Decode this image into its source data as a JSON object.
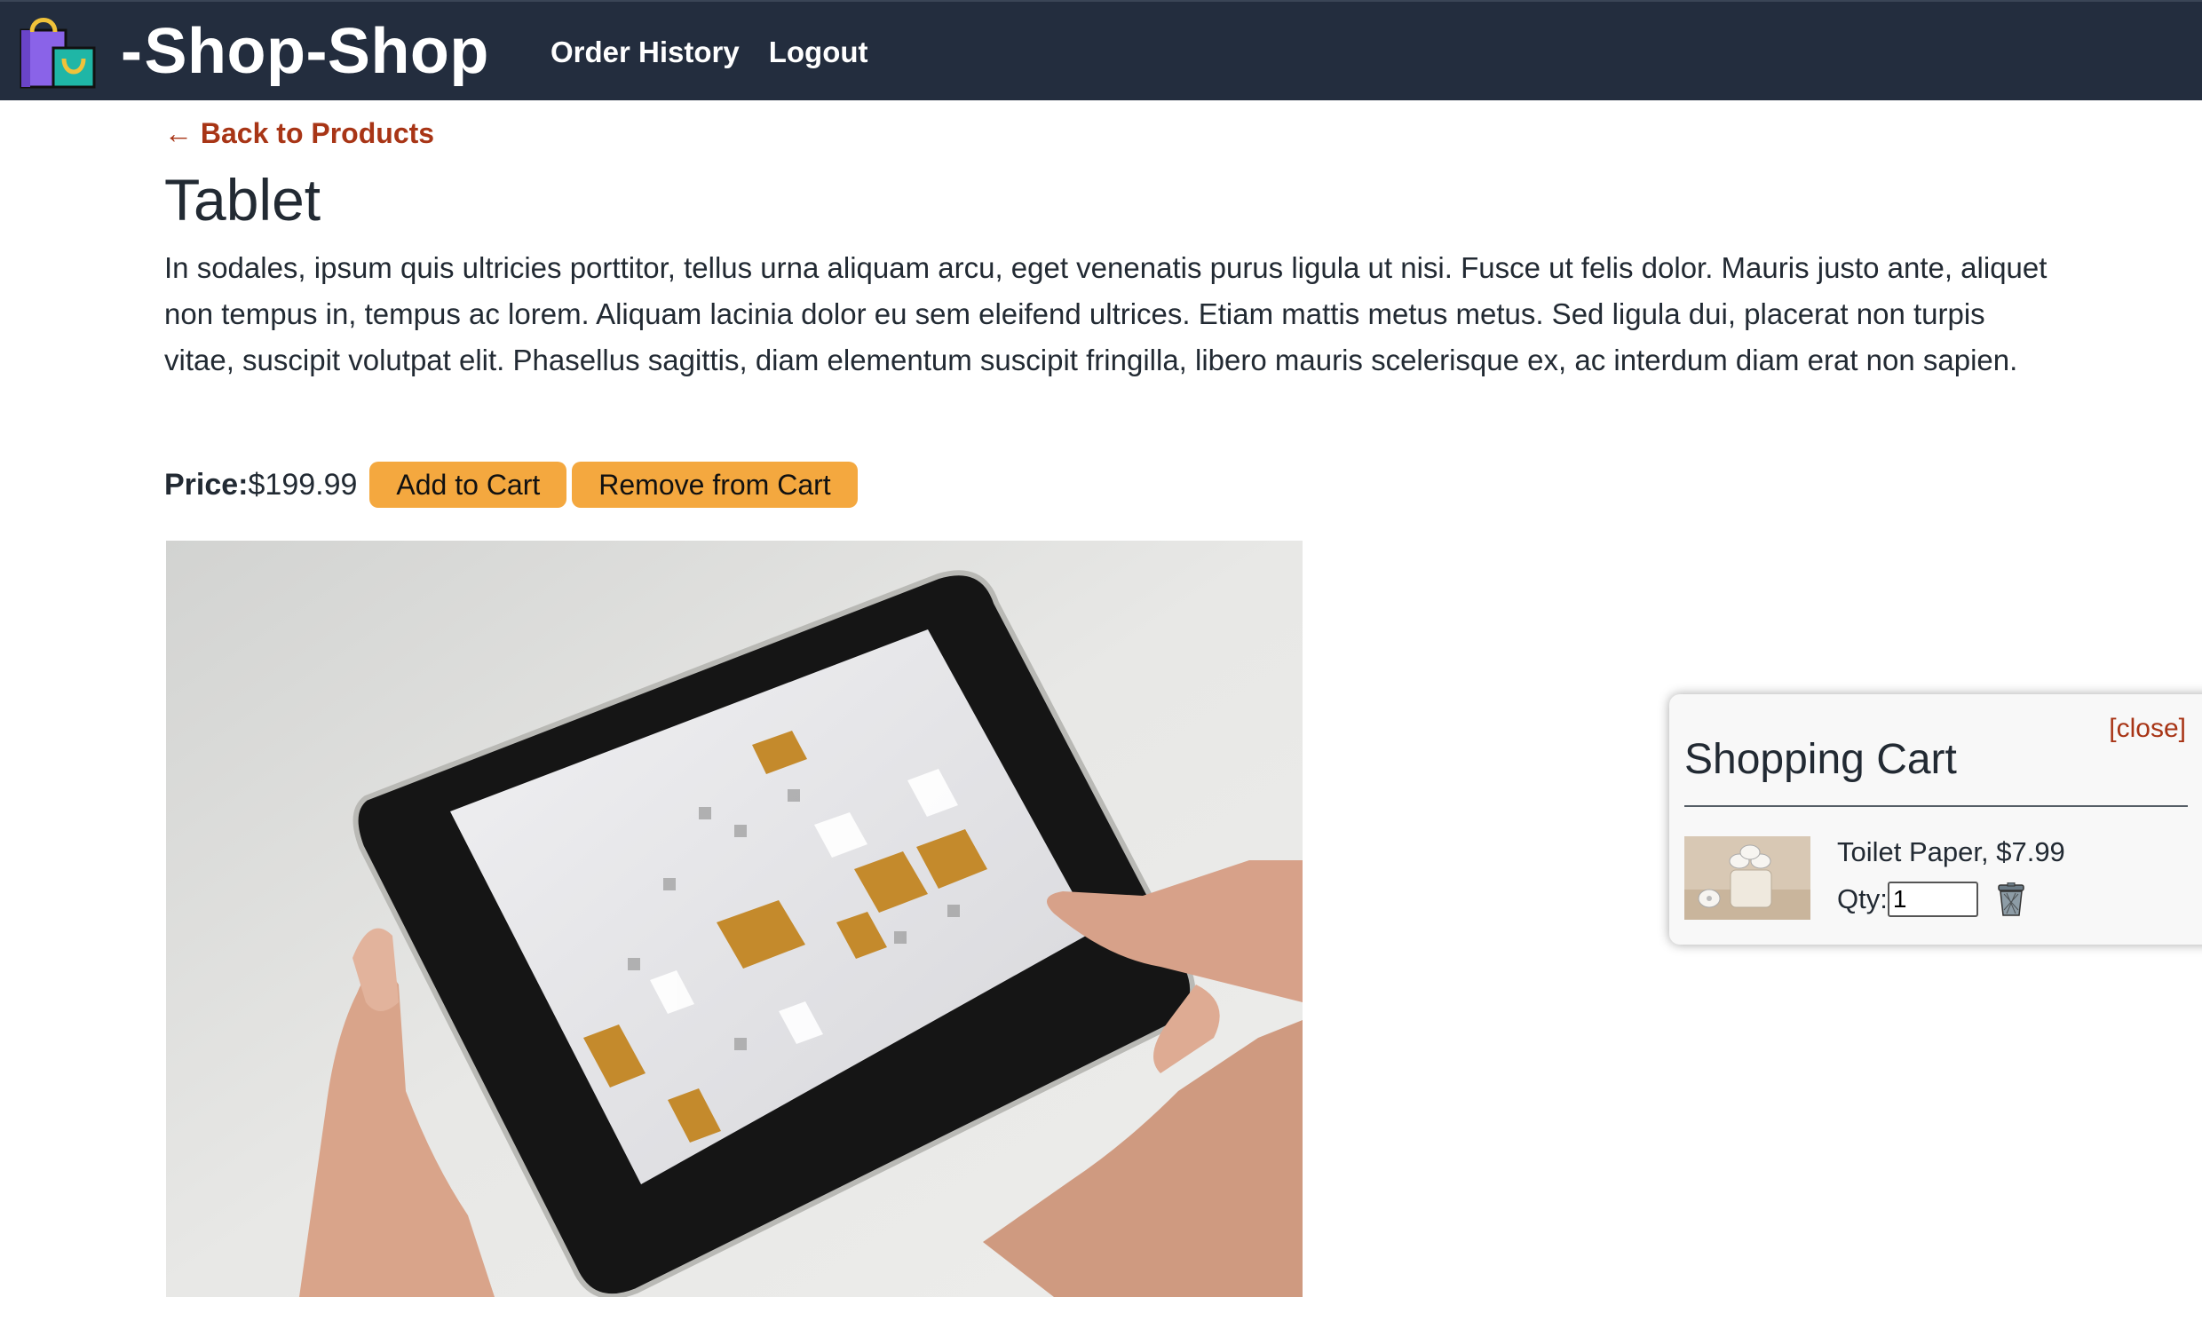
{
  "header": {
    "brand_icon": "shopping-bags-icon",
    "brand_dash": "-",
    "brand_name": "Shop-Shop",
    "nav": [
      {
        "label": "Order History"
      },
      {
        "label": "Logout"
      }
    ],
    "bg_color": "#232d3e"
  },
  "product": {
    "back_link": "← Back to Products",
    "title": "Tablet",
    "description": "In sodales, ipsum quis ultricies porttitor, tellus urna aliquam arcu, eget venenatis purus ligula ut nisi. Fusce ut felis dolor. Mauris justo ante, aliquet non tempus in, tempus ac lorem. Aliquam lacinia dolor eu sem eleifend ultrices. Etiam mattis metus metus. Sed ligula dui, placerat non turpis vitae, suscipit volutpat elit. Phasellus sagittis, diam elementum suscipit fringilla, libero mauris scelerisque ex, ac interdum diam erat non sapien.",
    "price_label": "Price:",
    "price_value": "$199.99",
    "add_button": "Add to Cart",
    "remove_button": "Remove from Cart",
    "image_icon": "tablet-photo",
    "button_color": "#f4a83f",
    "link_color": "#a83516"
  },
  "cart": {
    "close_label": "[close]",
    "title": "Shopping Cart",
    "items": [
      {
        "name": "Toilet Paper, $7.99",
        "qty_label": "Qty:",
        "qty_value": "1",
        "thumb_icon": "toilet-paper-photo",
        "delete_icon": "trash-icon"
      }
    ]
  }
}
